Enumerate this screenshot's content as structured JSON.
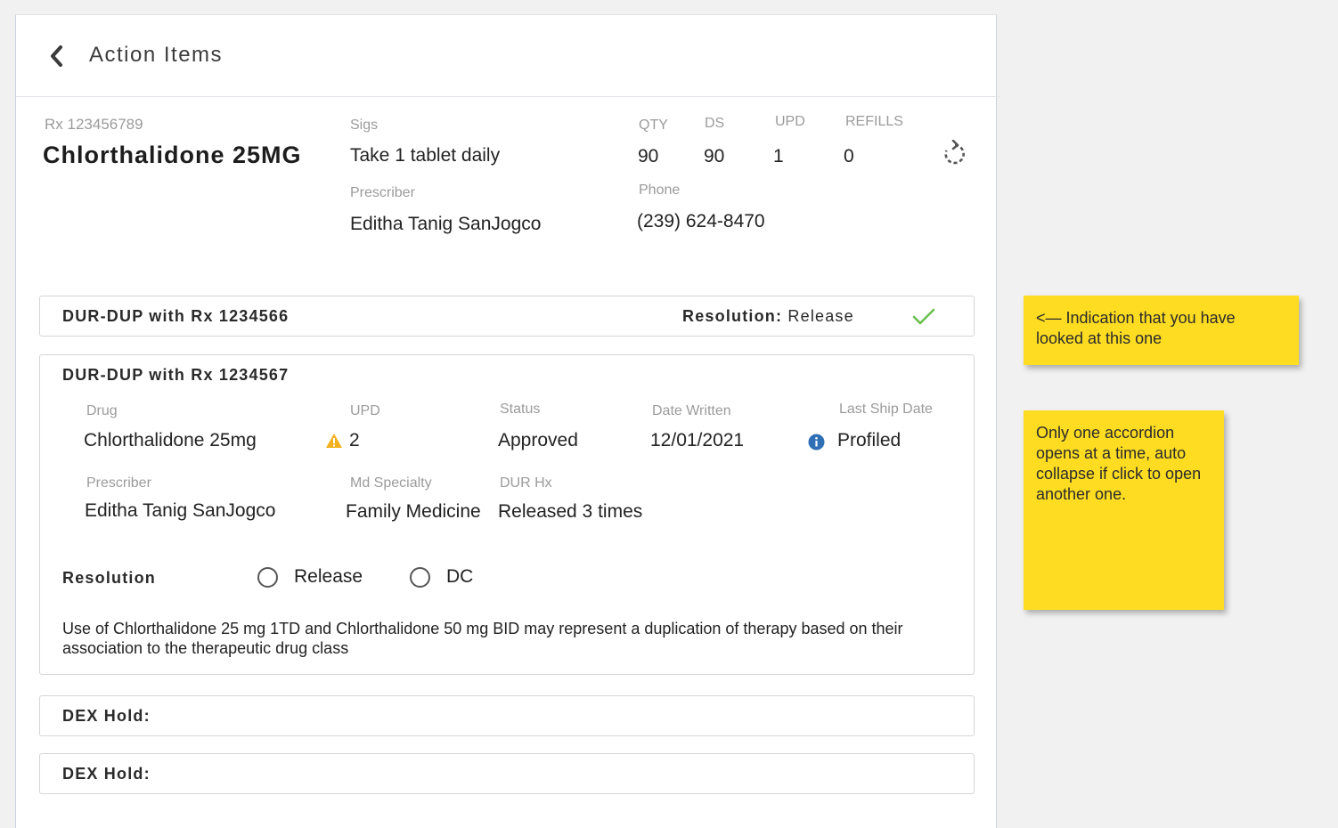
{
  "header": {
    "title": "Action Items"
  },
  "rx": {
    "number": "Rx 123456789",
    "drug_name": "Chlorthalidone 25MG",
    "sigs_label": "Sigs",
    "sigs_value": "Take 1 tablet daily",
    "prescriber_label": "Prescriber",
    "prescriber_value": "Editha Tanig SanJogco",
    "qty_label": "QTY",
    "qty_value": "90",
    "ds_label": "DS",
    "ds_value": "90",
    "upd_label": "UPD",
    "upd_value": "1",
    "refills_label": "REFILLS",
    "refills_value": "0",
    "phone_label": "Phone",
    "phone_value": "(239) 624-8470"
  },
  "accordions": [
    {
      "title": "DUR-DUP with Rx 1234566",
      "resolution_label": "Resolution:",
      "resolution_value": "Release"
    },
    {
      "title": "DUR-DUP with Rx 1234567",
      "drug_label": "Drug",
      "drug_value": "Chlorthalidone 25mg",
      "upd_label": "UPD",
      "upd_value": "2",
      "status_label": "Status",
      "status_value": "Approved",
      "date_written_label": "Date Written",
      "date_written_value": "12/01/2021",
      "last_ship_label": "Last Ship Date",
      "last_ship_value": "Profiled",
      "prescriber_label": "Prescriber",
      "prescriber_value": "Editha Tanig SanJogco",
      "specialty_label": "Md Specialty",
      "specialty_value": "Family Medicine",
      "dur_hx_label": "DUR Hx",
      "dur_hx_value": "Released 3 times",
      "resolution_label": "Resolution",
      "options": [
        "Release",
        "DC"
      ],
      "description": "Use of Chlorthalidone 25 mg 1TD and  Chlorthalidone 50 mg  BID may represent a duplication of therapy based on their association to the therapeutic drug class"
    },
    {
      "title": "DEX Hold:"
    },
    {
      "title": "DEX Hold:"
    }
  ],
  "notes": [
    "<— Indication that you have looked at this one",
    "Only one accordion opens at a time, auto collapse if click to open another one."
  ],
  "colors": {
    "check": "#6bbf4e",
    "warning": "#f2b01e",
    "info": "#2f6fb5",
    "sticky": "#fddc22"
  }
}
